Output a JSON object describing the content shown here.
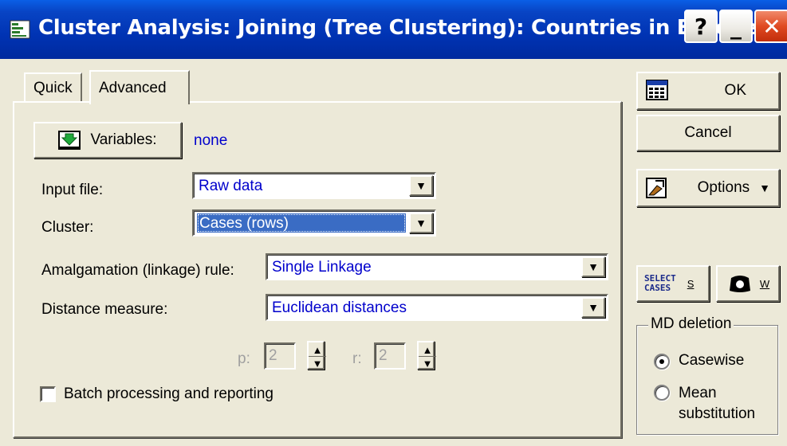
{
  "window": {
    "title": "Cluster Analysis: Joining (Tree Clustering): Countries in Europe i",
    "help_label": "?",
    "minimize_label": "_",
    "close_label": "✕"
  },
  "tabs": [
    {
      "label": "Quick",
      "active": false
    },
    {
      "label": "Advanced",
      "active": true
    }
  ],
  "variables": {
    "button_label": "Variables:",
    "value": "none"
  },
  "input_file": {
    "label": "Input file:",
    "value": "Raw data"
  },
  "cluster": {
    "label": "Cluster:",
    "value": "Cases (rows)"
  },
  "amalgamation": {
    "label": "Amalgamation (linkage) rule:",
    "value": "Single Linkage"
  },
  "distance": {
    "label": "Distance measure:",
    "value": "Euclidean distances"
  },
  "param_p": {
    "label": "p:",
    "value": "2"
  },
  "param_r": {
    "label": "r:",
    "value": "2"
  },
  "batch": {
    "label": "Batch processing and reporting",
    "checked": false
  },
  "right_panel": {
    "ok_label": "OK",
    "cancel_label": "Cancel",
    "options_label": "Options",
    "select_cases_line1": "SELECT",
    "select_cases_line2": "CASES",
    "select_cases_key": "S",
    "weight_key": "W"
  },
  "md_deletion": {
    "legend": "MD deletion",
    "options": [
      {
        "label": "Casewise",
        "selected": true
      },
      {
        "label": "Mean",
        "selected": false
      },
      {
        "label": "substitution",
        "selected": false
      }
    ]
  },
  "colors": {
    "title_bar": "#0033b3",
    "field_value_text": "#0000cc",
    "selection": "#3a6cc4",
    "dialog_bg": "#ece9d8"
  }
}
